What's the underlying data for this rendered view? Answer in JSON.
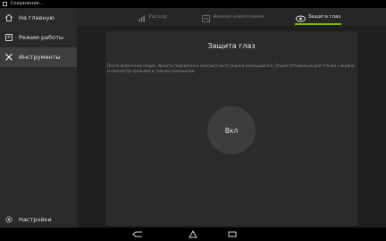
{
  "status": {
    "text": "Сохранение..."
  },
  "sidebar": {
    "items": [
      {
        "label": "На главную",
        "icon": "home-icon",
        "active": false
      },
      {
        "label": "Режим работы",
        "icon": "mode-icon",
        "active": false
      },
      {
        "label": "Инструменты",
        "icon": "tools-icon",
        "active": true
      }
    ],
    "settings": {
      "label": "Настройки",
      "icon": "gear-icon"
    }
  },
  "tabs": [
    {
      "label": "Расход",
      "icon": "consumption-icon",
      "active": false
    },
    {
      "label": "Анализ накопления",
      "icon": "analysis-icon",
      "active": false
    },
    {
      "label": "Защита глаз",
      "icon": "eye-protection-icon",
      "active": true
    }
  ],
  "main": {
    "title": "Защита глаз",
    "description": "После включения опции, яркость подсветки и контрастность экрана уменьшаются. Опция оптимальна для чтения с экрана и просмотра фильмов в темном помещении.",
    "toggle_label": "Вкл"
  },
  "colors": {
    "accent": "#76b900",
    "background": "#1f1f1f",
    "panel": "#2b2b2b"
  },
  "navbar": {
    "buttons": [
      "back-icon",
      "home-icon",
      "recents-icon"
    ]
  }
}
